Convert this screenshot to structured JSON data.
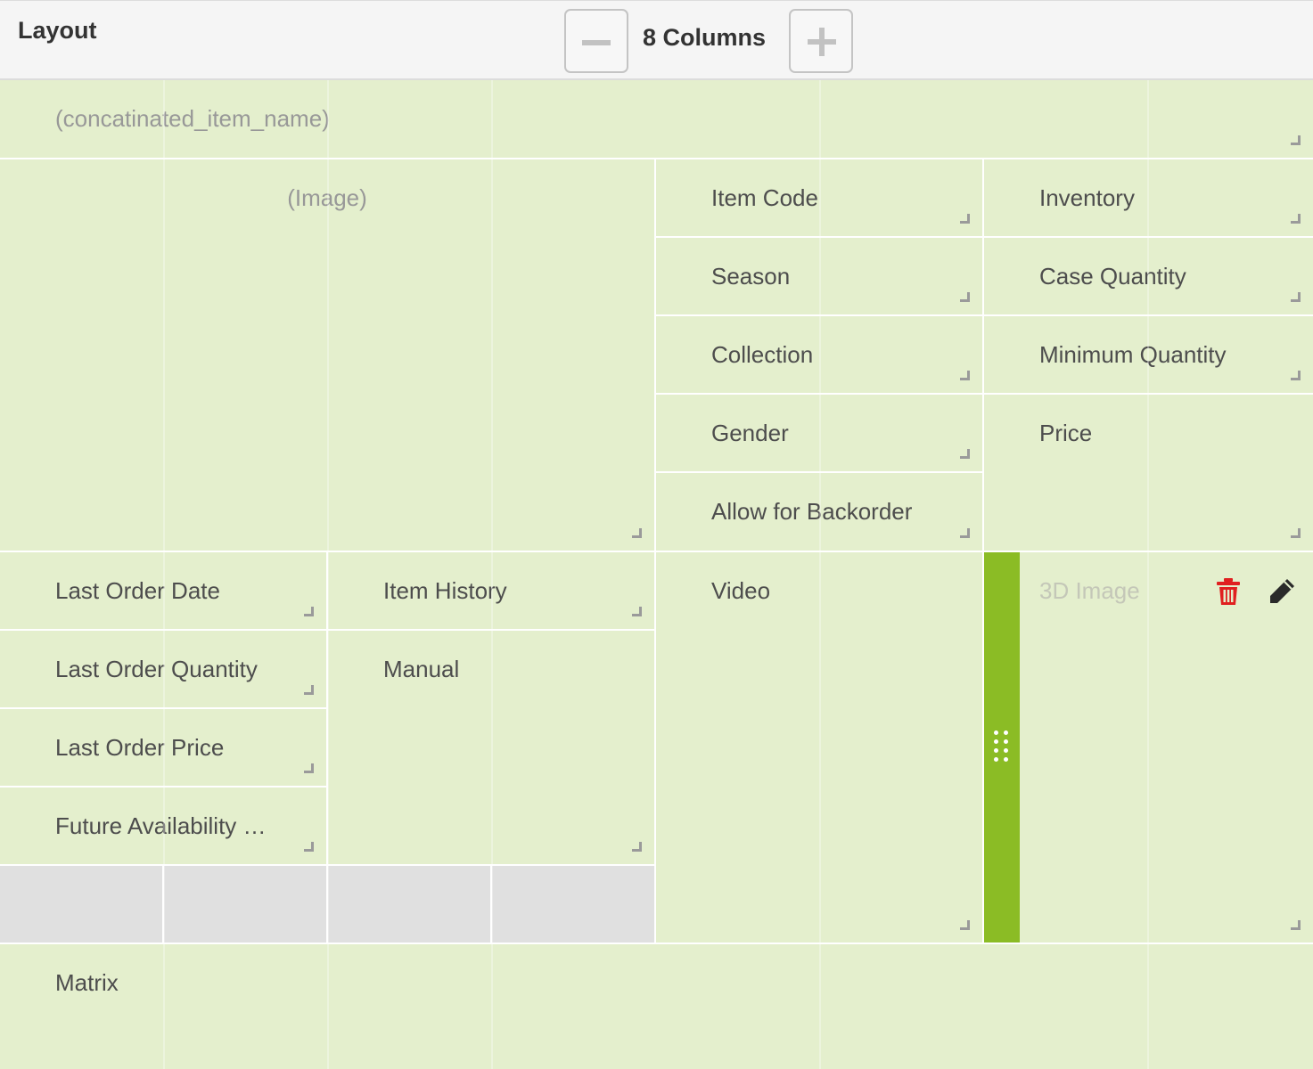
{
  "header": {
    "title": "Layout",
    "column_count": "8",
    "column_label": "Columns"
  },
  "cells": {
    "concat_name": "(concatinated_item_name)",
    "image": "(Image)",
    "item_code": "Item Code",
    "inventory": "Inventory",
    "season": "Season",
    "case_quantity": "Case Quantity",
    "collection": "Collection",
    "minimum_quantity": "Minimum Quantity",
    "gender": "Gender",
    "price": "Price",
    "allow_backorder": "Allow for Backorder",
    "last_order_date": "Last Order Date",
    "item_history": "Item History",
    "video": "Video",
    "image_3d": "3D Image",
    "last_order_quantity": "Last Order Quantity",
    "manual": "Manual",
    "last_order_price": "Last Order Price",
    "future_availability": "Future Availability …",
    "matrix": "Matrix"
  },
  "icons": {
    "minus": "minus-icon",
    "plus": "plus-icon",
    "trash": "trash-icon",
    "edit": "pencil-icon",
    "drag": "drag-handle-icon",
    "resize": "resize-handle-icon"
  },
  "colors": {
    "cell_background": "#e4efcd",
    "selected_accent": "#8bbc25",
    "empty_slot": "#e0e0e0",
    "delete_icon": "#e02020"
  }
}
